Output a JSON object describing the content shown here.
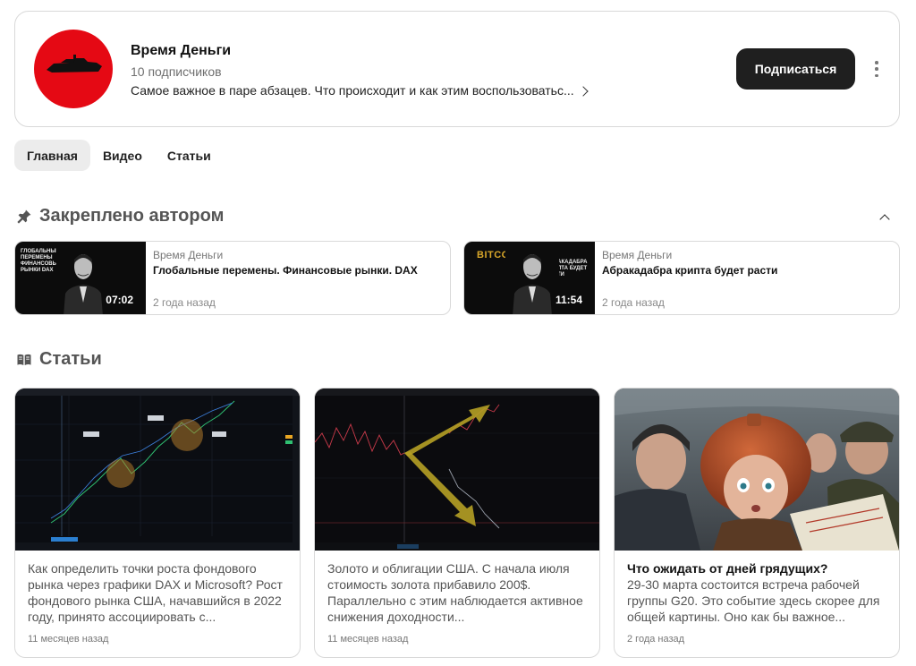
{
  "channel": {
    "name": "Время Деньги",
    "subscribers": "10 подписчиков",
    "description": "Самое важное в паре абзацев. Что происходит и как этим воспользоватьс...",
    "subscribe_label": "Подписаться",
    "avatar_color": "#e50914"
  },
  "tabs": [
    {
      "label": "Главная",
      "active": true
    },
    {
      "label": "Видео",
      "active": false
    },
    {
      "label": "Статьи",
      "active": false
    }
  ],
  "pinned": {
    "title": "Закреплено автором",
    "icon": "pin-icon",
    "items": [
      {
        "author": "Время Деньги",
        "title": "Глобальные перемены. Финансовые рынки. DAX",
        "time": "2 года назад",
        "duration": "07:02",
        "thumb_caption": "ГЛОБАЛЬНЫЕ ПЕРЕМЕНЫ ФИНАНСОВЫЕ РЫНКИ DAX"
      },
      {
        "author": "Время Деньги",
        "title": "Абракадабра крипта будет расти",
        "time": "2 года назад",
        "duration": "11:54",
        "thumb_caption": "BITCOIN",
        "thumb_caption_right": "АБРАКАДАБРА КРИПТА БУДЕТ РАСТИ"
      }
    ]
  },
  "articles": {
    "title": "Статьи",
    "icon": "book-icon",
    "items": [
      {
        "title": "",
        "text": "Как определить точки роста фондового рынка через графики DAX и Microsoft? Рост фондового рынка США, начавшийся в 2022 году, принято ассоциировать с...",
        "time": "11 месяцев назад"
      },
      {
        "title": "",
        "text": "Золото и облигации США. С начала июля стоимость золота прибавило 200$. Параллельно с этим наблюдается активное снижения доходности...",
        "time": "11 месяцев назад"
      },
      {
        "title": "Что ожидать от дней грядущих?",
        "text": "29-30 марта состоится встреча рабочей группы G20. Это событие здесь скорее для общей картины. Оно как бы важное...",
        "time": "2 года назад"
      }
    ]
  }
}
